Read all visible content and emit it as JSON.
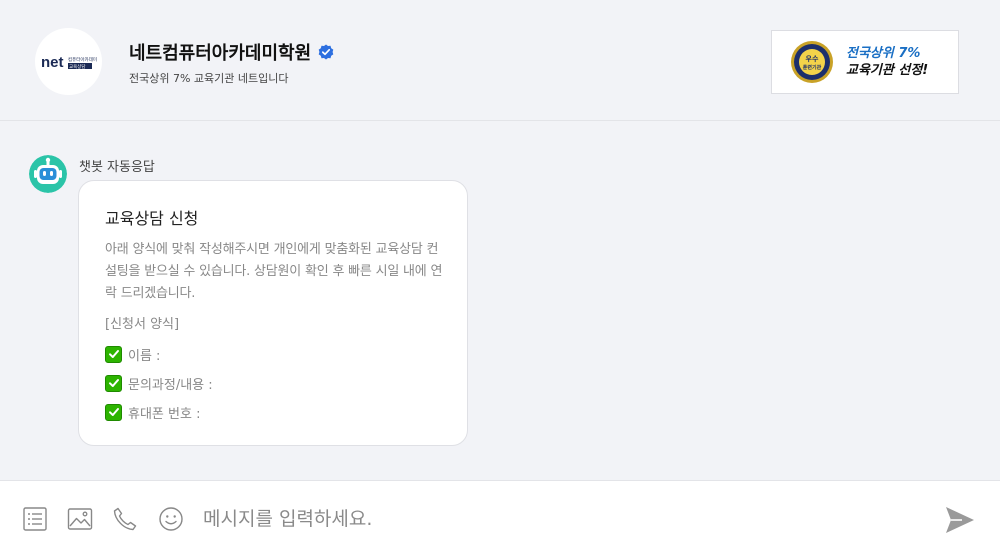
{
  "header": {
    "logo_text": "net",
    "logo_sub_line1": "컴퓨터아카데미",
    "logo_sub_line2": "교육상담",
    "org_name": "네트컴퓨터아카데미학원",
    "org_subtitle": "전국상위 7% 교육기관 네트입니다",
    "badge": {
      "seal_line1": "우수",
      "seal_line2": "훈련기관",
      "line1": "전국상위 7%",
      "line2": "교육기관 선정!"
    }
  },
  "chat": {
    "bot_name": "챗봇 자동응답",
    "message": {
      "title": "교육상담 신청",
      "body": "아래 양식에 맞춰 작성해주시면 개인에게 맞춤화된 교육상담 컨설팅을 받으실 수 있습니다. 상담원이 확인 후 빠른 시일 내에 연락 드리겠습니다.",
      "form_label": "[신청서 양식]",
      "fields": [
        "이름 :",
        "문의과정/내용 :",
        "휴대폰 번호 :"
      ]
    }
  },
  "input": {
    "placeholder": "메시지를 입력하세요."
  },
  "colors": {
    "accent": "#2d6fe0",
    "check_green": "#2db400",
    "bot_teal": "#2bc4a8"
  }
}
